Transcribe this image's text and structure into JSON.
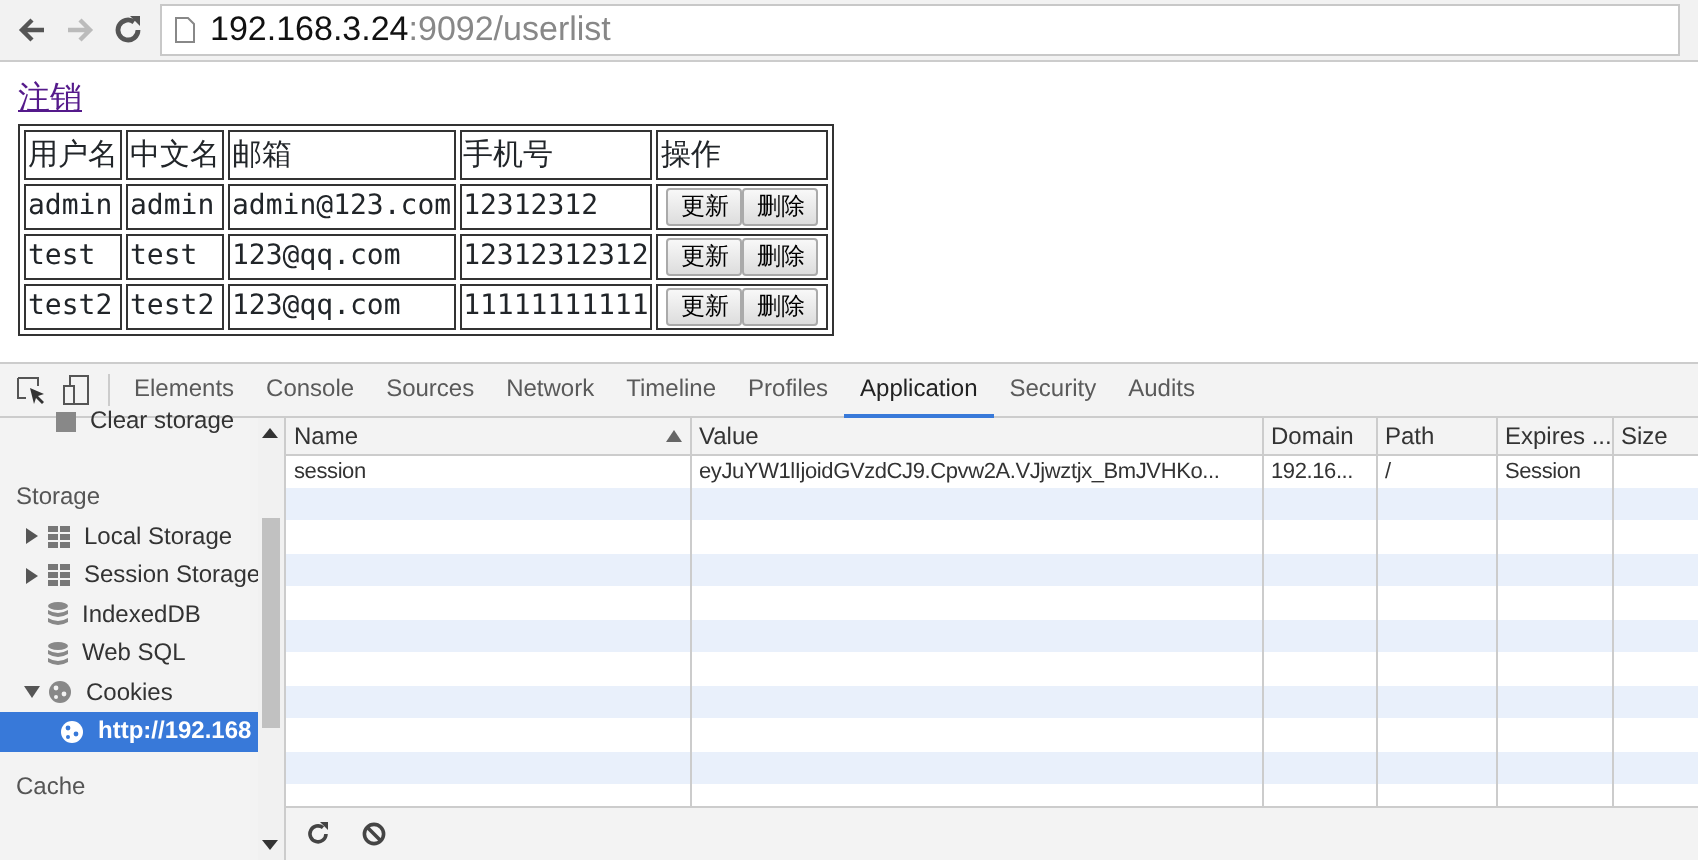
{
  "browser": {
    "address_host": "192.168.3.24",
    "address_rest": ":9092/userlist"
  },
  "page": {
    "logout_link": "注销",
    "table": {
      "columns": [
        "用户名",
        "中文名",
        "邮箱",
        "手机号",
        "操作"
      ],
      "rows": [
        {
          "cells": [
            "admin",
            "admin",
            "admin@123.com",
            "12312312"
          ],
          "actions": [
            "更新",
            "删除"
          ]
        },
        {
          "cells": [
            "test",
            "test",
            "123@qq.com",
            "12312312312"
          ],
          "actions": [
            "更新",
            "删除"
          ]
        },
        {
          "cells": [
            "test2",
            "test2",
            "123@qq.com",
            "11111111111"
          ],
          "actions": [
            "更新",
            "删除"
          ]
        }
      ]
    }
  },
  "devtools": {
    "tabs": [
      {
        "label": "Elements",
        "selected": false
      },
      {
        "label": "Console",
        "selected": false
      },
      {
        "label": "Sources",
        "selected": false
      },
      {
        "label": "Network",
        "selected": false
      },
      {
        "label": "Timeline",
        "selected": false
      },
      {
        "label": "Profiles",
        "selected": false
      },
      {
        "label": "Application",
        "selected": true
      },
      {
        "label": "Security",
        "selected": false
      },
      {
        "label": "Audits",
        "selected": false
      }
    ],
    "sidebar": [
      {
        "kind": "item",
        "label": "Clear storage"
      },
      {
        "kind": "header",
        "label": "Storage"
      },
      {
        "kind": "storage",
        "label": "Local Storage",
        "expanded": false
      },
      {
        "kind": "storage",
        "label": "Session Storage",
        "expanded": false
      },
      {
        "kind": "database",
        "label": "IndexedDB"
      },
      {
        "kind": "database",
        "label": "Web SQL"
      },
      {
        "kind": "cookies",
        "label": "Cookies",
        "expanded": true,
        "children": [
          {
            "kind": "cookie",
            "label": "http://192.168",
            "selected": true
          }
        ]
      },
      {
        "kind": "header",
        "label": "Cache"
      }
    ],
    "cookies": {
      "columns": [
        {
          "label": "Name",
          "sorted": true
        },
        {
          "label": "Value",
          "sorted": false
        },
        {
          "label": "Domain",
          "sorted": false
        },
        {
          "label": "Path",
          "sorted": false
        },
        {
          "label": "Expires ...",
          "sorted": false
        },
        {
          "label": "Size",
          "sorted": false
        }
      ],
      "rows": [
        [
          "session",
          "eyJuYW1lIjoidGVzdCJ9.Cpvw2A.VJjwztjx_BmJVHKo...",
          "192.16...",
          "/",
          "Session"
        ]
      ]
    }
  }
}
